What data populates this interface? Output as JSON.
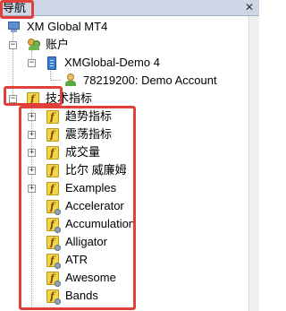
{
  "navigator": {
    "title": "导航",
    "close_glyph": "✕"
  },
  "tree": {
    "root": "XM Global MT4",
    "accounts": "账户",
    "server": "XMGlobal-Demo 4",
    "account": "78219200: Demo Account",
    "indicators": "技术指标",
    "items": [
      "趋势指标",
      "震荡指标",
      "成交量",
      "比尔 威廉姆",
      "Examples",
      "Accelerator",
      "Accumulation",
      "Alligator",
      "ATR",
      "Awesome",
      "Bands"
    ]
  }
}
